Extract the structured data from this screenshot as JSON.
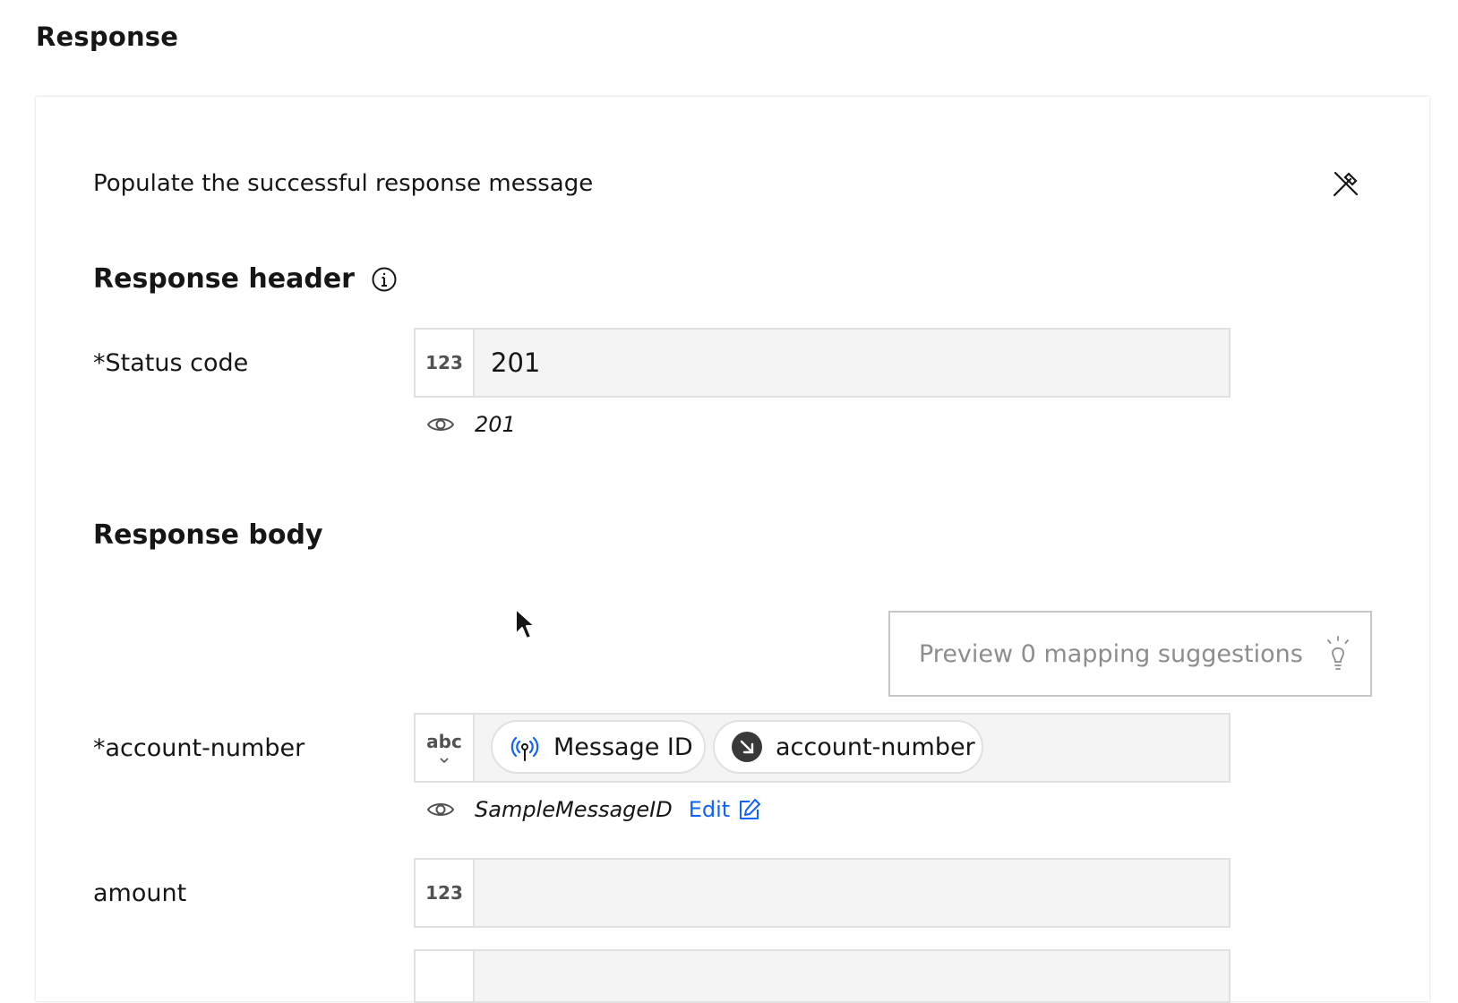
{
  "page": {
    "title": "Response"
  },
  "card": {
    "subtitle": "Populate the successful response message",
    "response_header": {
      "heading": "Response header",
      "status_code": {
        "label": "*Status code",
        "type_badge": "123",
        "value": "201",
        "preview": "201"
      }
    },
    "response_body": {
      "heading": "Response body",
      "suggestions_button": "Preview 0 mapping suggestions",
      "account_number": {
        "label": "*account-number",
        "type_badge": "abc",
        "pills": [
          {
            "label": "Message ID",
            "icon": "message-id-icon"
          },
          {
            "label": "account-number",
            "icon": "input-arrow-icon"
          }
        ],
        "preview": "SampleMessageID",
        "edit_label": "Edit"
      },
      "amount": {
        "label": "amount",
        "type_badge": "123",
        "value": ""
      }
    }
  },
  "colors": {
    "link": "#0f62fe",
    "field_bg": "#f4f4f4",
    "border": "#e0e0e0",
    "placeholder_text": "#8d8d8d"
  }
}
